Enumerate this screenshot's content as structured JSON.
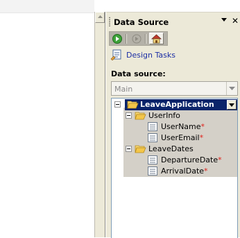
{
  "pane": {
    "title": "Data Source",
    "dropdown_icon": "triangle-down-icon",
    "close_icon": "close-icon"
  },
  "nav_toolbar": {
    "buttons": [
      "go-forward-green-icon",
      "go-disabled-icon",
      "home-icon"
    ]
  },
  "design_tasks": {
    "label": "Design Tasks",
    "icon": "design-tasks-icon"
  },
  "data_source": {
    "label": "Data source:",
    "value": "Main"
  },
  "tree": {
    "root": {
      "label": "LeaveApplication"
    },
    "groups": [
      {
        "label": "UserInfo",
        "fields": [
          {
            "label": "UserName",
            "required_mark": "*"
          },
          {
            "label": "UserEmail",
            "required_mark": "*"
          }
        ]
      },
      {
        "label": "LeaveDates",
        "fields": [
          {
            "label": "DepartureDate",
            "required_mark": "*"
          },
          {
            "label": "ArrivalDate",
            "required_mark": "*"
          }
        ]
      }
    ]
  },
  "colors": {
    "pane_bg": "#ece9d8",
    "selection_bg": "#0a246a",
    "link": "#1d2fa5",
    "required": "#e0201a",
    "folder": "#f3c64a"
  }
}
